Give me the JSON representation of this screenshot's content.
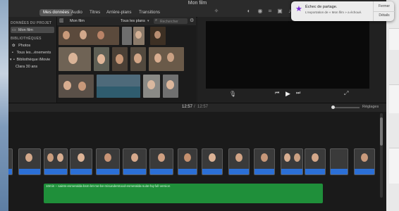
{
  "window": {
    "title": "Mon film"
  },
  "tabs": [
    "Mes données",
    "Audio",
    "Titres",
    "Arrière-plans",
    "Transitions"
  ],
  "sidebar": {
    "project_header": "DONNÉES DU PROJET",
    "project_item": "Mon film",
    "libraries_header": "BIBLIOTHÈQUES",
    "items": [
      "Photos",
      "Tous les...énements",
      "Bibliothèque iMovie",
      "Clara 30 ans"
    ]
  },
  "browser": {
    "title": "Mon film",
    "filter": "Tous les plans",
    "search_placeholder": "Rechercher"
  },
  "timecode": {
    "current": "12:57",
    "separator": "/",
    "total": "12:57"
  },
  "settings_label": "Réglages",
  "audio_clip": {
    "label": "10min – saints-esmeralda-bsm-let-me-be-misunderstood-esmeralda-suite-hq-full-version"
  },
  "notification": {
    "title": "Échec de partage.",
    "message": "L'exportation de « Mon film » a échoué.",
    "close": "Fermer",
    "details": "Détails"
  },
  "icons": {
    "share": "share-icon",
    "play": "play-icon",
    "prev": "skip-back-icon",
    "next": "skip-forward-icon",
    "mic": "microphone-icon",
    "fullscreen": "fullscreen-icon",
    "gear": "gear-icon",
    "search": "search-icon",
    "star": "star-icon"
  },
  "colors": {
    "audio_green": "#1f8f3a",
    "waveform_blue": "#2b6fd6",
    "tab_active": "#555555",
    "notif_icon": "#7a2fd6"
  }
}
